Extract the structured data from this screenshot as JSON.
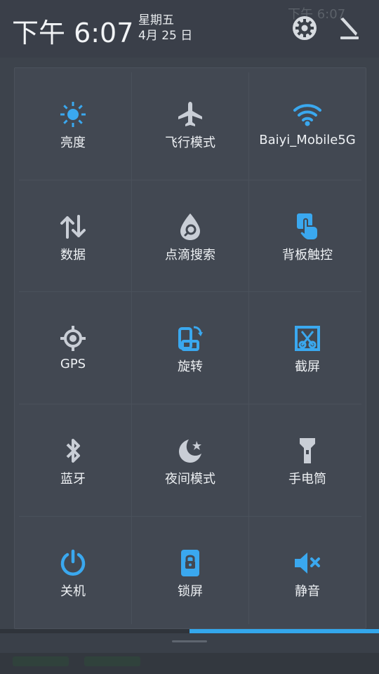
{
  "header": {
    "time": "下午 6:07",
    "weekday": "星期五",
    "date": "4月 25 日",
    "settings_icon": "gear-icon",
    "edit_icon": "edit-icon"
  },
  "status_bar": {
    "ghost_time": "下午 6:07"
  },
  "tiles": [
    {
      "label": "亮度",
      "icon": "brightness-icon",
      "color": "#3aa8ef"
    },
    {
      "label": "飞行模式",
      "icon": "airplane-icon",
      "color": "#c9ced6"
    },
    {
      "label": "Baiyi_Mobile5G",
      "icon": "wifi-icon",
      "color": "#3aa8ef"
    },
    {
      "label": "数据",
      "icon": "data-icon",
      "color": "#c9ced6"
    },
    {
      "label": "点滴搜索",
      "icon": "drop-search-icon",
      "color": "#c9ced6"
    },
    {
      "label": "背板触控",
      "icon": "touch-icon",
      "color": "#3aa8ef"
    },
    {
      "label": "GPS",
      "icon": "gps-icon",
      "color": "#c9ced6"
    },
    {
      "label": "旋转",
      "icon": "rotate-icon",
      "color": "#3aa8ef"
    },
    {
      "label": "截屏",
      "icon": "screenshot-icon",
      "color": "#3aa8ef"
    },
    {
      "label": "蓝牙",
      "icon": "bluetooth-icon",
      "color": "#c9ced6"
    },
    {
      "label": "夜间模式",
      "icon": "night-mode-icon",
      "color": "#c9ced6"
    },
    {
      "label": "手电筒",
      "icon": "flashlight-icon",
      "color": "#c9ced6"
    },
    {
      "label": "关机",
      "icon": "power-icon",
      "color": "#3aa8ef"
    },
    {
      "label": "锁屏",
      "icon": "lock-screen-icon",
      "color": "#3aa8ef"
    },
    {
      "label": "静音",
      "icon": "mute-icon",
      "color": "#3aa8ef"
    }
  ],
  "page_indicator": {
    "current": 2,
    "total": 2
  }
}
